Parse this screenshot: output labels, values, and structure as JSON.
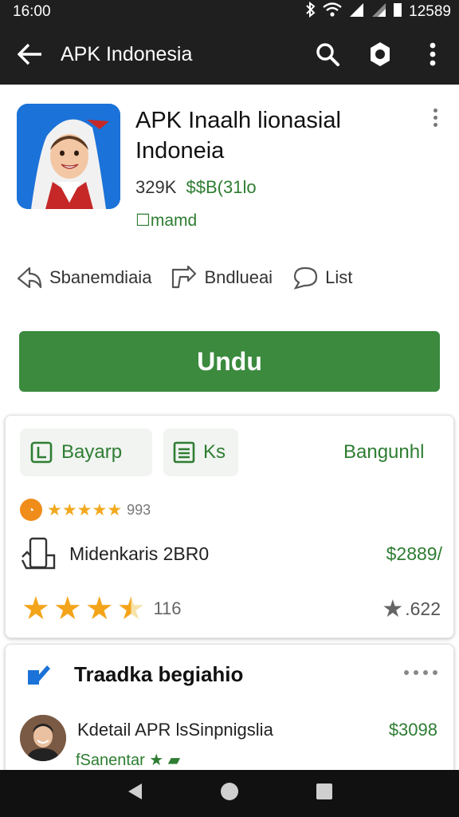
{
  "status": {
    "time": "16:00",
    "battery": "12589"
  },
  "toolbar": {
    "title": "APK Indonesia"
  },
  "app": {
    "title_line1": "APK Inaalh lionasial",
    "title_line2": "Indoneia",
    "size": "329K",
    "price": "$$B(31lo",
    "badge": "☐mamd"
  },
  "actions": [
    {
      "label": "Sbanemdiaia",
      "icon": "share-icon"
    },
    {
      "label": "Bndlueai",
      "icon": "forward-icon"
    },
    {
      "label": "List",
      "icon": "chat-bubble-icon"
    }
  ],
  "install": {
    "label": "Undu"
  },
  "card1": {
    "chip1": "Bayarp",
    "chip2": "Ks",
    "link": "Bangunhl",
    "small_count": "993",
    "device_name": "Midenkaris 2BR0",
    "device_value": "$2889/",
    "rating_count": "116",
    "rating_score": ".622",
    "rating_value": 3.5
  },
  "card2": {
    "title": "Traadka begiahio",
    "dev_name": "Kdetail APR lsSinpnigslia",
    "dev_price": "$3098",
    "dev_tag": "fSanentar"
  },
  "colors": {
    "accent": "#3b8a3e",
    "star": "#f4a41a",
    "bar": "#1f1f1f"
  }
}
